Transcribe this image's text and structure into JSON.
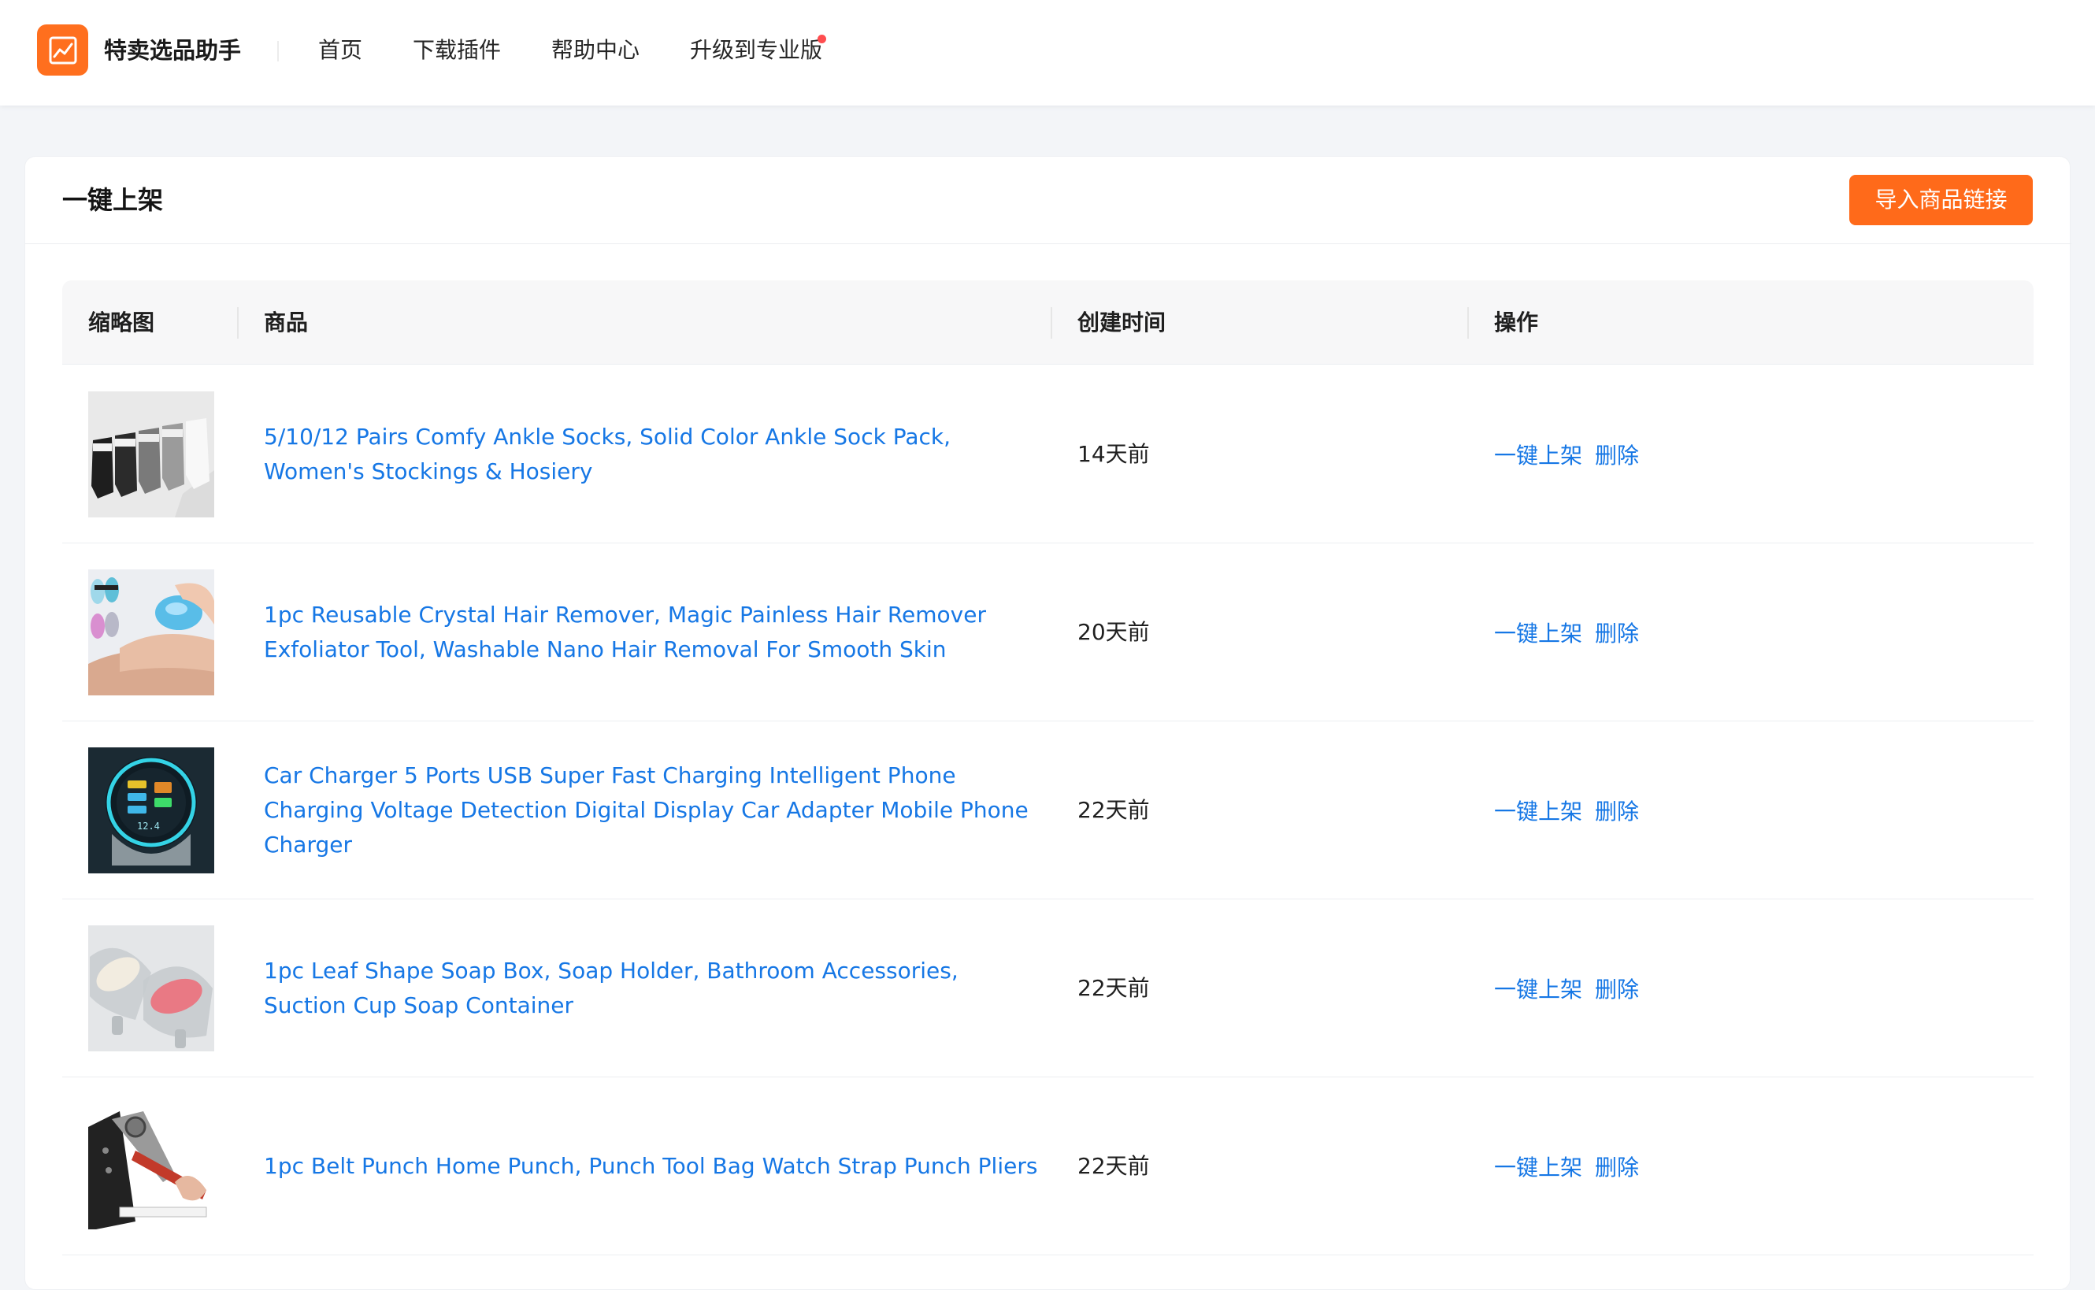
{
  "app": {
    "brand": "特卖选品助手",
    "logo_icon": "trend-chart-icon",
    "accent_color": "#ff6a1a",
    "link_color": "#1677e5"
  },
  "nav": {
    "items": [
      "首页",
      "下载插件",
      "帮助中心",
      "升级到专业版"
    ],
    "badge_color": "#ff4d4f"
  },
  "page": {
    "title": "一键上架",
    "import_button": "导入商品链接"
  },
  "table": {
    "headers": [
      "缩略图",
      "商品",
      "创建时间",
      "操作"
    ],
    "rows": [
      {
        "thumbnail": "socks-image",
        "title": "5/10/12 Pairs Comfy Ankle Socks, Solid Color Ankle Sock Pack, Women's Stockings & Hosiery",
        "created": "14天前",
        "action_publish": "一键上架",
        "action_delete": "删除"
      },
      {
        "thumbnail": "hair-remover-image",
        "title": "1pc Reusable Crystal Hair Remover, Magic Painless Hair Remover Exfoliator Tool, Washable Nano Hair Removal For Smooth Skin",
        "created": "20天前",
        "action_publish": "一键上架",
        "action_delete": "删除"
      },
      {
        "thumbnail": "car-charger-image",
        "title": "Car Charger 5 Ports USB Super Fast Charging Intelligent Phone Charging Voltage Detection Digital Display Car Adapter Mobile Phone Charger",
        "created": "22天前",
        "action_publish": "一键上架",
        "action_delete": "删除"
      },
      {
        "thumbnail": "soap-box-image",
        "title": "1pc Leaf Shape Soap Box, Soap Holder, Bathroom Accessories, Suction Cup Soap Container",
        "created": "22天前",
        "action_publish": "一键上架",
        "action_delete": "删除"
      },
      {
        "thumbnail": "belt-punch-image",
        "title": "1pc Belt Punch Home Punch, Punch Tool Bag Watch Strap Punch Pliers",
        "created": "22天前",
        "action_publish": "一键上架",
        "action_delete": "删除"
      }
    ]
  }
}
